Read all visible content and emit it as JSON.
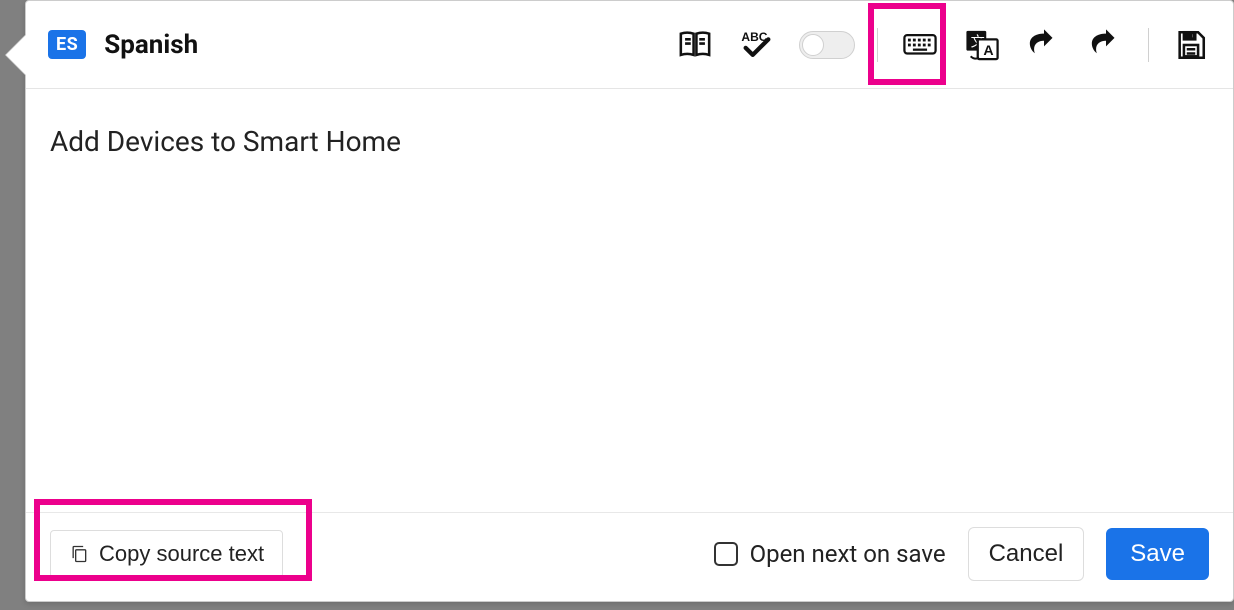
{
  "language": {
    "code": "ES",
    "name": "Spanish"
  },
  "toolbar": {
    "icons": {
      "dictionary": "dictionary",
      "spellcheck": "spellcheck",
      "toggle": "toggle",
      "keyboard": "keyboard",
      "machine_translate": "machine-translate",
      "undo": "undo",
      "redo": "redo",
      "save": "save"
    }
  },
  "editor": {
    "text": "Add Devices to Smart Home"
  },
  "footer": {
    "copy_source_label": "Copy source text",
    "open_next_label": "Open next on save",
    "open_next_checked": false,
    "cancel_label": "Cancel",
    "save_label": "Save"
  },
  "highlights": {
    "machine_translate": true,
    "copy_source": true
  }
}
